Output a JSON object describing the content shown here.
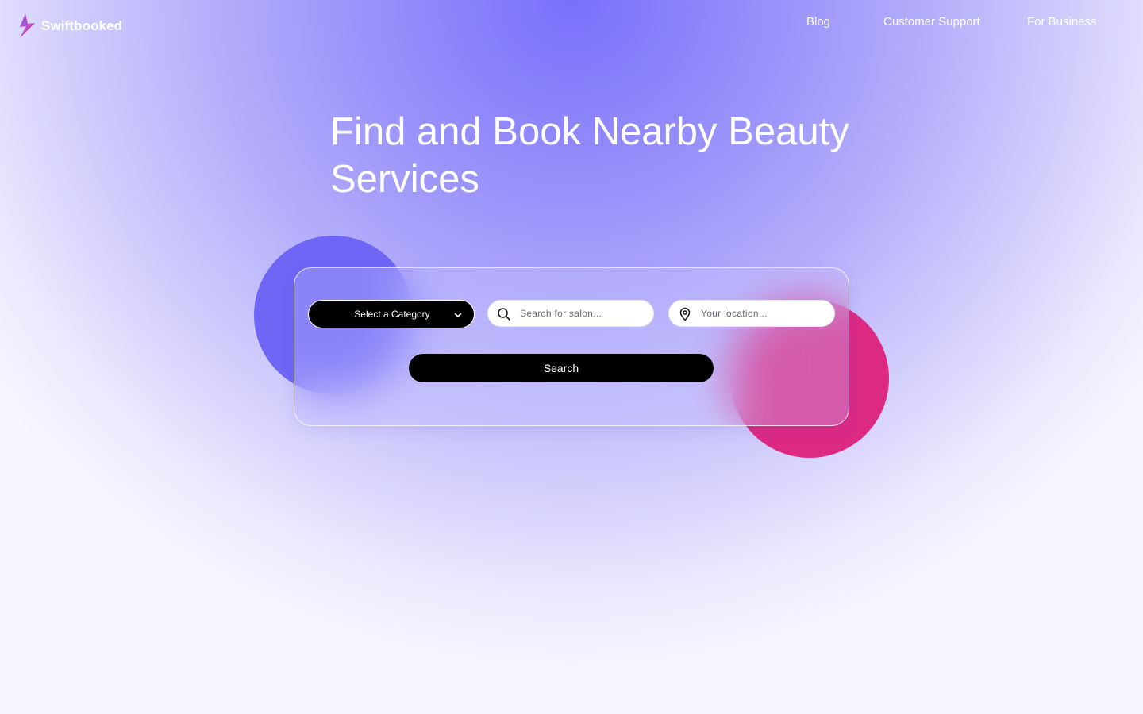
{
  "app": {
    "brand": "Swiftbooked"
  },
  "header": {
    "nav": [
      {
        "label": "Blog"
      },
      {
        "label": "Customer Support"
      },
      {
        "label": "For Business"
      }
    ]
  },
  "hero": {
    "title": "Find and Book Nearby Beauty Services"
  },
  "search": {
    "category": {
      "selected": "Select a Category",
      "icon": "chevron-down-icon"
    },
    "salon": {
      "placeholder": "Search for salon...",
      "value": "",
      "icon": "search-icon"
    },
    "location": {
      "placeholder": "Your location...",
      "value": "",
      "icon": "map-pin-icon"
    },
    "button_label": "Search"
  },
  "colors": {
    "accent_primary": "#7a6ffb",
    "accent_secondary": "#dc2a83",
    "button": "#000000",
    "text_on_accent": "#ffffff"
  }
}
